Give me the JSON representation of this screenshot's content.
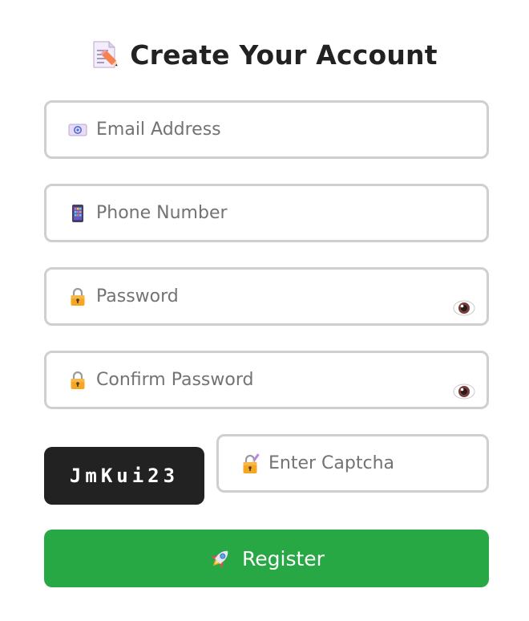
{
  "header": {
    "title": "Create Your Account",
    "icon": "memo-pencil-icon"
  },
  "form": {
    "email": {
      "placeholder": "Email Address",
      "value": "",
      "icon": "email-icon"
    },
    "phone": {
      "placeholder": "Phone Number",
      "value": "",
      "icon": "mobile-phone-icon"
    },
    "password": {
      "placeholder": "Password",
      "value": "",
      "icon": "lock-icon",
      "toggle_icon": "eye-icon"
    },
    "confirm_password": {
      "placeholder": "Confirm Password",
      "value": "",
      "icon": "lock-icon",
      "toggle_icon": "eye-icon"
    },
    "captcha": {
      "code": "JmKui23",
      "placeholder": "Enter Captcha",
      "value": "",
      "icon": "lock-with-pen-icon"
    },
    "register_label": "Register",
    "register_icon": "rocket-icon"
  },
  "colors": {
    "primary_button": "#28a745",
    "captcha_bg": "#222222",
    "border": "#cfcfcf",
    "title_text": "#222222"
  }
}
